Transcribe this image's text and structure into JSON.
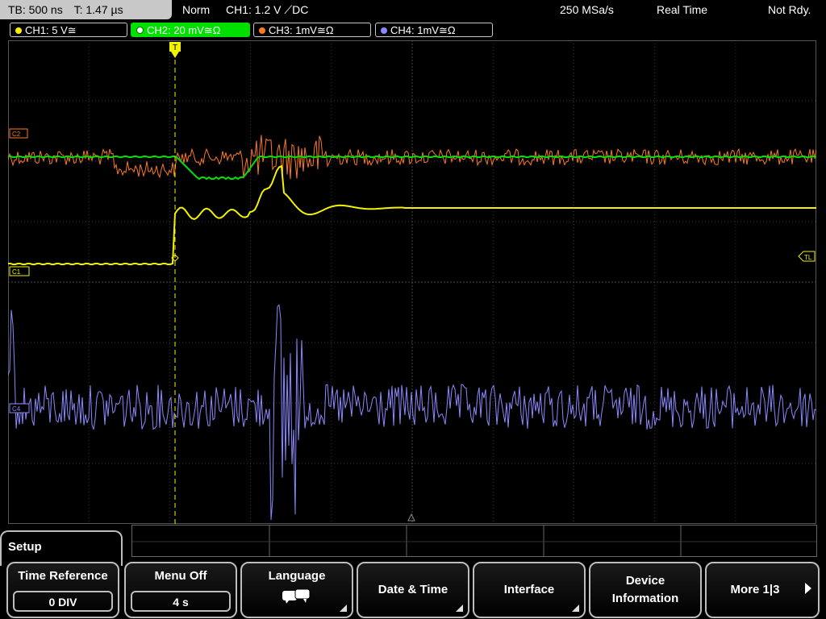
{
  "status": {
    "timebase": "TB: 500 ns",
    "trigger_time": "T: 1.47 µs",
    "mode": "Norm",
    "trigger_info": "CH1: 1.2 V ⟋DC",
    "sample_rate": "250 MSa/s",
    "acq_mode": "Real Time",
    "state": "Not Rdy."
  },
  "channels": [
    {
      "label": "CH1: 5 V≅",
      "color": "#f2f200"
    },
    {
      "label": "CH2: 20 mV≅Ω",
      "color": "#00e000"
    },
    {
      "label": "CH3: 1mV≅Ω",
      "color": "#ff7a1a"
    },
    {
      "label": "CH4: 1mV≅Ω",
      "color": "#8c88ff"
    }
  ],
  "markers": {
    "ch1": "C1",
    "ch2": "C2",
    "ch4": "C4",
    "trigger_level": "TL",
    "trigger_pos": "T"
  },
  "menu": {
    "title": "Setup",
    "time_reference": {
      "label": "Time Reference",
      "value": "0 DIV"
    },
    "menu_off": {
      "label": "Menu Off",
      "value": "4 s"
    },
    "language": {
      "label": "Language",
      "icon": "speech-bubbles-icon"
    },
    "date_time": {
      "label": "Date & Time"
    },
    "interface": {
      "label": "Interface"
    },
    "device_info": {
      "line1": "Device",
      "line2": "Information"
    },
    "more": {
      "label": "More 1|3"
    }
  }
}
